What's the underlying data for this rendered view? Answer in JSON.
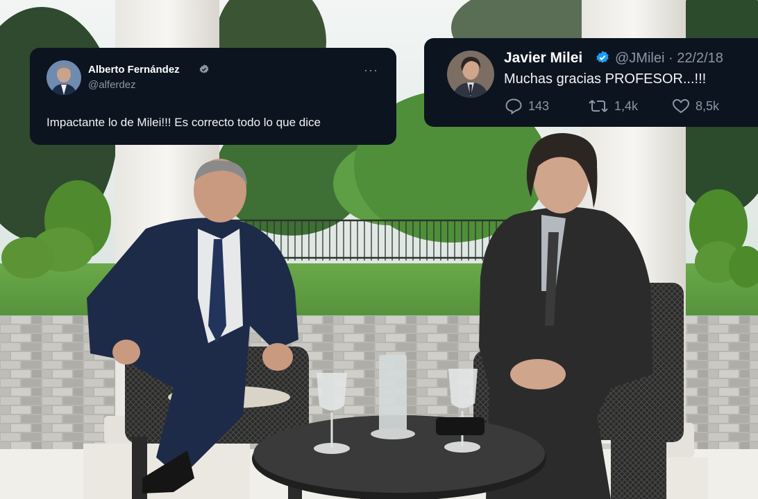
{
  "tweets": [
    {
      "name": "Alberto Fernández",
      "handle": "@alferdez",
      "text": "Impactante lo de Milei!!! Es correcto todo lo que dice",
      "more": "···"
    },
    {
      "name": "Javier Milei",
      "handle": "@JMilei · 22/2/18",
      "text": "Muchas gracias PROFESOR...!!!",
      "replies": "143",
      "retweets": "1,4k",
      "likes": "8,5k"
    }
  ],
  "colors": {
    "card_bg": "#0c1420",
    "verified": "#1d9bf0",
    "muted": "#8b98a5"
  }
}
